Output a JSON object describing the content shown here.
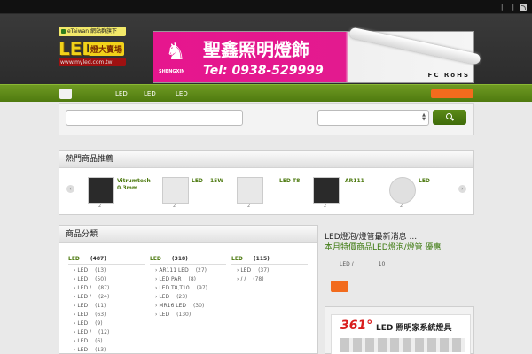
{
  "topbar": {
    "links": "| |",
    "rss_icon": "rss-icon"
  },
  "header": {
    "tag": "eTaiwan 網站群旗下",
    "logo_led": "LED",
    "logo_cn": "燈大賣場",
    "logo_url": "www.myled.com.tw"
  },
  "banner": {
    "brand": "SHENGXIN",
    "title": "聖鑫照明燈飾",
    "tel": "Tel: 0938-529999",
    "certs": "FC RoHS"
  },
  "nav": {
    "items": [
      "LED",
      "LED",
      "LED"
    ]
  },
  "popular": {
    "title": "熱門商品推薦",
    "products": [
      {
        "name": "Vitrumtech",
        "sub": "0.3mm",
        "num": "2"
      },
      {
        "name": "LED",
        "sub": "",
        "num": "2",
        "extra": "15W"
      },
      {
        "name": "LED T8",
        "sub": "",
        "num": "2"
      },
      {
        "name": "AR111",
        "sub": "",
        "num": "2"
      },
      {
        "name": "LED",
        "sub": "",
        "num": "2"
      }
    ]
  },
  "categories": {
    "title": "商品分類",
    "columns": [
      {
        "header": "LED",
        "count": "(487)",
        "rows": [
          {
            "label": "LED",
            "count": "(13)"
          },
          {
            "label": "LED",
            "count": "(50)"
          },
          {
            "label": "LED /",
            "count": "(87)"
          },
          {
            "label": "LED /",
            "count": "(24)"
          },
          {
            "label": "LED",
            "count": "(11)"
          },
          {
            "label": "LED",
            "count": "(63)"
          },
          {
            "label": "LED",
            "count": "(9)"
          },
          {
            "label": "LED /",
            "count": "(12)"
          },
          {
            "label": "LED",
            "count": "(6)"
          },
          {
            "label": "LED",
            "count": "(13)"
          }
        ]
      },
      {
        "header": "LED",
        "count": "(318)",
        "rows": [
          {
            "label": "AR111 LED",
            "count": "(27)"
          },
          {
            "label": "LED PAR",
            "count": "(8)"
          },
          {
            "label": "LED T8,T10",
            "count": "(97)"
          },
          {
            "label": "LED",
            "count": "(23)"
          },
          {
            "label": "MR16 LED",
            "count": "(30)"
          },
          {
            "label": "LED",
            "count": "(130)"
          }
        ]
      },
      {
        "header": "LED",
        "count": "(115)",
        "rows": [
          {
            "label": "LED",
            "count": "(37)"
          },
          {
            "label": "/ /",
            "count": "(78)"
          }
        ]
      }
    ]
  },
  "news": {
    "title": "LED燈泡/燈管最新消息 ...",
    "link": "本月特價商品LED燈泡/燈管 優惠",
    "line_label": "LED /",
    "line_num": "10"
  },
  "ad": {
    "brand": "361°",
    "text": "LED 照明家系統燈具"
  },
  "colors": {
    "green": "#4f7a10",
    "orange": "#f26b1d",
    "pink": "#e31a8f"
  }
}
